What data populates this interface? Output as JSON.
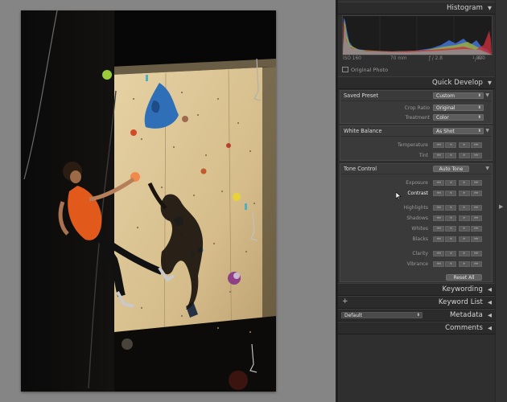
{
  "histogram": {
    "title": "Histogram",
    "iso": "ISO 160",
    "focal": "70 mm",
    "aperture": "ƒ / 2.8",
    "shutter_num": "1",
    "shutter_den": "320",
    "shutter_unit": "SEC",
    "original_photo": "Original Photo"
  },
  "quick_develop": {
    "title": "Quick Develop",
    "saved_preset": {
      "label": "Saved Preset",
      "value": "Custom"
    },
    "crop_ratio": {
      "label": "Crop Ratio",
      "value": "Original"
    },
    "treatment": {
      "label": "Treatment",
      "value": "Color"
    },
    "white_balance": {
      "label": "White Balance",
      "value": "As Shot"
    },
    "temperature": "Temperature",
    "tint": "Tint",
    "tone_control": {
      "label": "Tone Control",
      "auto_tone": "Auto Tone"
    },
    "exposure": "Exposure",
    "contrast": "Contrast",
    "highlights": "Highlights",
    "shadows": "Shadows",
    "whites": "Whites",
    "blacks": "Blacks",
    "clarity": "Clarity",
    "vibrance": "Vibrance",
    "reset_all": "Reset All"
  },
  "keywording": {
    "title": "Keywording"
  },
  "keyword_list": {
    "title": "Keyword List",
    "plus": "+"
  },
  "metadata": {
    "title": "Metadata",
    "preset": "Default"
  },
  "comments": {
    "title": "Comments"
  },
  "icons": {
    "expand": "▼",
    "collapse": "◀",
    "popup": "⬍",
    "stepper": [
      "◂◂",
      "◂",
      "▸",
      "▸▸"
    ]
  }
}
